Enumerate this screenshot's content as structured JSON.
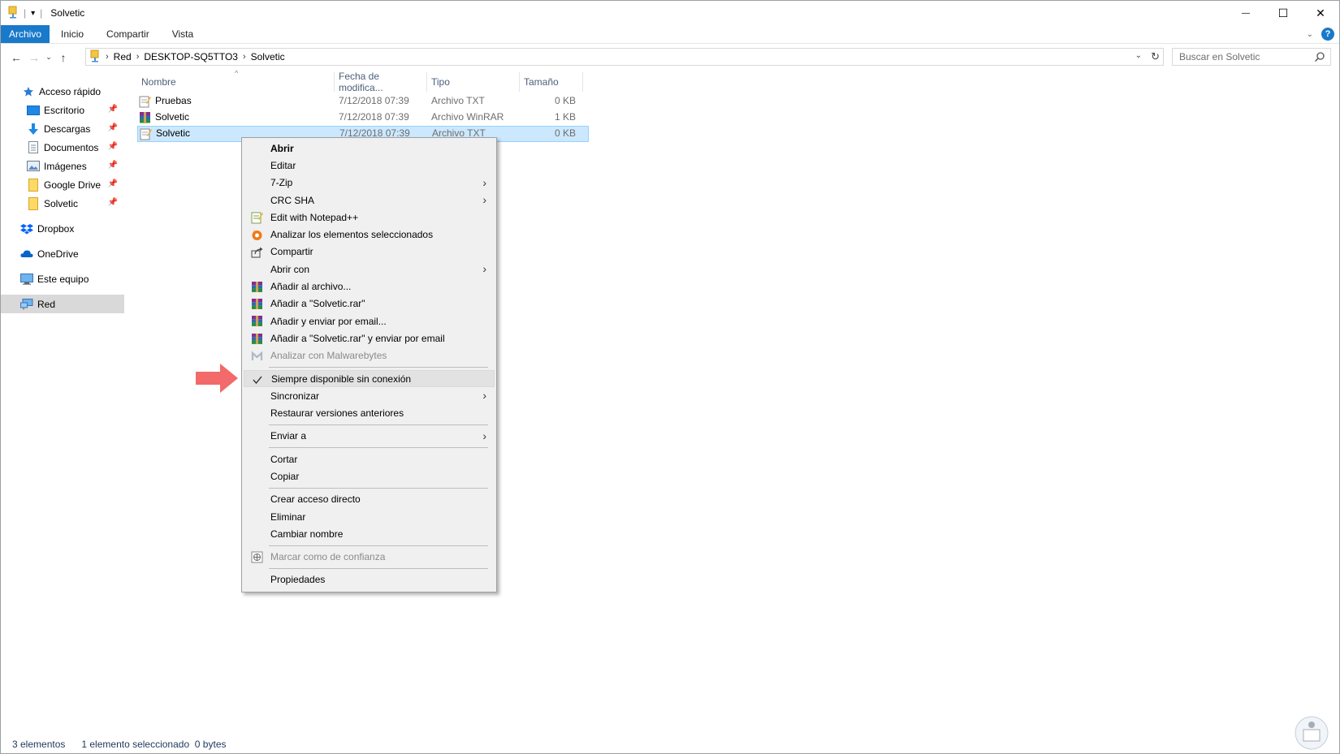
{
  "window": {
    "title": "Solvetic",
    "controls": {
      "minimize": "—",
      "maximize": "☐",
      "close": "✕"
    }
  },
  "ribbon": {
    "tabs": [
      "Archivo",
      "Inicio",
      "Compartir",
      "Vista"
    ],
    "help": "?"
  },
  "address": {
    "crumbs": [
      "Red",
      "DESKTOP-SQ5TTO3",
      "Solvetic"
    ],
    "search_placeholder": "Buscar en Solvetic"
  },
  "sidebar": {
    "items": [
      {
        "label": "Acceso rápido",
        "icon": "star-icon",
        "pinned": false
      },
      {
        "label": "Escritorio",
        "icon": "desktop-icon",
        "pinned": true
      },
      {
        "label": "Descargas",
        "icon": "download-icon",
        "pinned": true
      },
      {
        "label": "Documentos",
        "icon": "document-icon",
        "pinned": true
      },
      {
        "label": "Imágenes",
        "icon": "image-icon",
        "pinned": true
      },
      {
        "label": "Google Drive",
        "icon": "folder-icon",
        "pinned": true
      },
      {
        "label": "Solvetic",
        "icon": "folder-icon",
        "pinned": true
      },
      {
        "label": "Dropbox",
        "icon": "dropbox-icon",
        "pinned": false
      },
      {
        "label": "OneDrive",
        "icon": "cloud-icon",
        "pinned": false
      },
      {
        "label": "Este equipo",
        "icon": "computer-icon",
        "pinned": false
      },
      {
        "label": "Red",
        "icon": "network-icon",
        "pinned": false,
        "selected": true
      }
    ]
  },
  "file_list": {
    "columns": [
      "Nombre",
      "Fecha de modifica...",
      "Tipo",
      "Tamaño"
    ],
    "rows": [
      {
        "name": "Pruebas",
        "date": "7/12/2018 07:39",
        "type": "Archivo TXT",
        "size": "0 KB",
        "icon": "text-file-icon",
        "selected": false
      },
      {
        "name": "Solvetic",
        "date": "7/12/2018 07:39",
        "type": "Archivo WinRAR",
        "size": "1 KB",
        "icon": "winrar-file-icon",
        "selected": false
      },
      {
        "name": "Solvetic",
        "date": "7/12/2018 07:39",
        "type": "Archivo TXT",
        "size": "0 KB",
        "icon": "text-file-icon",
        "selected": true
      }
    ]
  },
  "context_menu": {
    "items": [
      {
        "label": "Abrir",
        "bold": true
      },
      {
        "label": "Editar"
      },
      {
        "label": "7-Zip",
        "submenu": true
      },
      {
        "label": "CRC SHA",
        "submenu": true
      },
      {
        "label": "Edit with Notepad++",
        "icon": "notepadpp-icon"
      },
      {
        "label": "Analizar los elementos seleccionados",
        "icon": "avast-icon"
      },
      {
        "label": "Compartir",
        "icon": "share-icon"
      },
      {
        "label": "Abrir con",
        "submenu": true
      },
      {
        "label": "Añadir al archivo...",
        "icon": "winrar-icon"
      },
      {
        "label": "Añadir a \"Solvetic.rar\"",
        "icon": "winrar-icon"
      },
      {
        "label": "Añadir y enviar por email...",
        "icon": "winrar-icon"
      },
      {
        "label": "Añadir a \"Solvetic.rar\" y enviar por email",
        "icon": "winrar-icon"
      },
      {
        "label": "Analizar con Malwarebytes",
        "icon": "malwarebytes-icon",
        "disabled": true
      },
      {
        "separator": true
      },
      {
        "label": "Siempre disponible sin conexión",
        "icon": "checkmark-icon",
        "highlighted": true
      },
      {
        "label": "Sincronizar",
        "submenu": true
      },
      {
        "label": "Restaurar versiones anteriores"
      },
      {
        "separator": true
      },
      {
        "label": "Enviar a",
        "submenu": true
      },
      {
        "separator": true
      },
      {
        "label": "Cortar"
      },
      {
        "label": "Copiar"
      },
      {
        "separator": true
      },
      {
        "label": "Crear acceso directo"
      },
      {
        "label": "Eliminar"
      },
      {
        "label": "Cambiar nombre"
      },
      {
        "separator": true
      },
      {
        "label": "Marcar como de confianza",
        "icon": "shield-icon",
        "disabled": true
      },
      {
        "separator": true
      },
      {
        "label": "Propiedades"
      }
    ]
  },
  "status": {
    "count": "3 elementos",
    "selection": "1 elemento seleccionado  0 bytes"
  },
  "colors": {
    "accent": "#1979ca",
    "selection_bg": "#cce8ff",
    "selection_border": "#99d1ff",
    "pointer_arrow": "#f26a6a"
  }
}
